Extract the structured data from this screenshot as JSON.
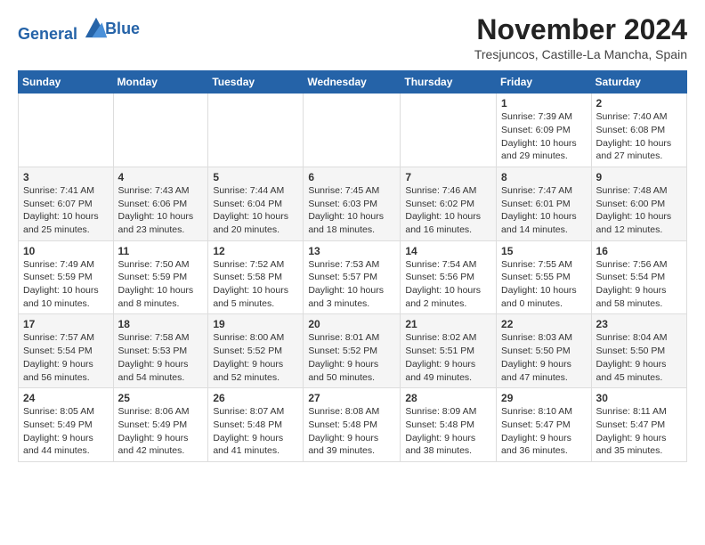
{
  "header": {
    "logo_line1": "General",
    "logo_line2": "Blue",
    "month": "November 2024",
    "location": "Tresjuncos, Castille-La Mancha, Spain"
  },
  "days_of_week": [
    "Sunday",
    "Monday",
    "Tuesday",
    "Wednesday",
    "Thursday",
    "Friday",
    "Saturday"
  ],
  "weeks": [
    [
      {
        "day": "",
        "info": ""
      },
      {
        "day": "",
        "info": ""
      },
      {
        "day": "",
        "info": ""
      },
      {
        "day": "",
        "info": ""
      },
      {
        "day": "",
        "info": ""
      },
      {
        "day": "1",
        "info": "Sunrise: 7:39 AM\nSunset: 6:09 PM\nDaylight: 10 hours and 29 minutes."
      },
      {
        "day": "2",
        "info": "Sunrise: 7:40 AM\nSunset: 6:08 PM\nDaylight: 10 hours and 27 minutes."
      }
    ],
    [
      {
        "day": "3",
        "info": "Sunrise: 7:41 AM\nSunset: 6:07 PM\nDaylight: 10 hours and 25 minutes."
      },
      {
        "day": "4",
        "info": "Sunrise: 7:43 AM\nSunset: 6:06 PM\nDaylight: 10 hours and 23 minutes."
      },
      {
        "day": "5",
        "info": "Sunrise: 7:44 AM\nSunset: 6:04 PM\nDaylight: 10 hours and 20 minutes."
      },
      {
        "day": "6",
        "info": "Sunrise: 7:45 AM\nSunset: 6:03 PM\nDaylight: 10 hours and 18 minutes."
      },
      {
        "day": "7",
        "info": "Sunrise: 7:46 AM\nSunset: 6:02 PM\nDaylight: 10 hours and 16 minutes."
      },
      {
        "day": "8",
        "info": "Sunrise: 7:47 AM\nSunset: 6:01 PM\nDaylight: 10 hours and 14 minutes."
      },
      {
        "day": "9",
        "info": "Sunrise: 7:48 AM\nSunset: 6:00 PM\nDaylight: 10 hours and 12 minutes."
      }
    ],
    [
      {
        "day": "10",
        "info": "Sunrise: 7:49 AM\nSunset: 5:59 PM\nDaylight: 10 hours and 10 minutes."
      },
      {
        "day": "11",
        "info": "Sunrise: 7:50 AM\nSunset: 5:59 PM\nDaylight: 10 hours and 8 minutes."
      },
      {
        "day": "12",
        "info": "Sunrise: 7:52 AM\nSunset: 5:58 PM\nDaylight: 10 hours and 5 minutes."
      },
      {
        "day": "13",
        "info": "Sunrise: 7:53 AM\nSunset: 5:57 PM\nDaylight: 10 hours and 3 minutes."
      },
      {
        "day": "14",
        "info": "Sunrise: 7:54 AM\nSunset: 5:56 PM\nDaylight: 10 hours and 2 minutes."
      },
      {
        "day": "15",
        "info": "Sunrise: 7:55 AM\nSunset: 5:55 PM\nDaylight: 10 hours and 0 minutes."
      },
      {
        "day": "16",
        "info": "Sunrise: 7:56 AM\nSunset: 5:54 PM\nDaylight: 9 hours and 58 minutes."
      }
    ],
    [
      {
        "day": "17",
        "info": "Sunrise: 7:57 AM\nSunset: 5:54 PM\nDaylight: 9 hours and 56 minutes."
      },
      {
        "day": "18",
        "info": "Sunrise: 7:58 AM\nSunset: 5:53 PM\nDaylight: 9 hours and 54 minutes."
      },
      {
        "day": "19",
        "info": "Sunrise: 8:00 AM\nSunset: 5:52 PM\nDaylight: 9 hours and 52 minutes."
      },
      {
        "day": "20",
        "info": "Sunrise: 8:01 AM\nSunset: 5:52 PM\nDaylight: 9 hours and 50 minutes."
      },
      {
        "day": "21",
        "info": "Sunrise: 8:02 AM\nSunset: 5:51 PM\nDaylight: 9 hours and 49 minutes."
      },
      {
        "day": "22",
        "info": "Sunrise: 8:03 AM\nSunset: 5:50 PM\nDaylight: 9 hours and 47 minutes."
      },
      {
        "day": "23",
        "info": "Sunrise: 8:04 AM\nSunset: 5:50 PM\nDaylight: 9 hours and 45 minutes."
      }
    ],
    [
      {
        "day": "24",
        "info": "Sunrise: 8:05 AM\nSunset: 5:49 PM\nDaylight: 9 hours and 44 minutes."
      },
      {
        "day": "25",
        "info": "Sunrise: 8:06 AM\nSunset: 5:49 PM\nDaylight: 9 hours and 42 minutes."
      },
      {
        "day": "26",
        "info": "Sunrise: 8:07 AM\nSunset: 5:48 PM\nDaylight: 9 hours and 41 minutes."
      },
      {
        "day": "27",
        "info": "Sunrise: 8:08 AM\nSunset: 5:48 PM\nDaylight: 9 hours and 39 minutes."
      },
      {
        "day": "28",
        "info": "Sunrise: 8:09 AM\nSunset: 5:48 PM\nDaylight: 9 hours and 38 minutes."
      },
      {
        "day": "29",
        "info": "Sunrise: 8:10 AM\nSunset: 5:47 PM\nDaylight: 9 hours and 36 minutes."
      },
      {
        "day": "30",
        "info": "Sunrise: 8:11 AM\nSunset: 5:47 PM\nDaylight: 9 hours and 35 minutes."
      }
    ]
  ]
}
